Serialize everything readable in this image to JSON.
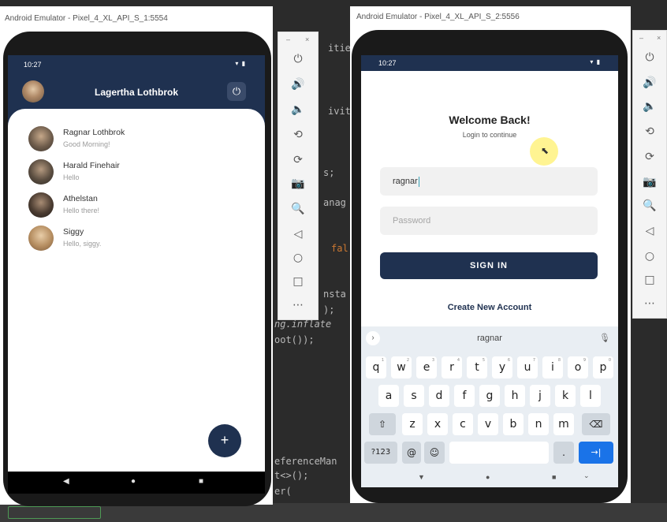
{
  "emulators": [
    {
      "title": "Android Emulator - Pixel_4_XL_API_S_1:5554"
    },
    {
      "title": "Android Emulator - Pixel_4_XL_API_S_2:5556"
    }
  ],
  "toolbar": {
    "minimize": "–",
    "close": "×",
    "icons": [
      "power-icon",
      "volume-up-icon",
      "volume-down-icon",
      "rotate-left-icon",
      "rotate-right-icon",
      "camera-icon",
      "zoom-icon",
      "back-icon",
      "home-icon",
      "overview-icon",
      "more-icon"
    ],
    "glyphs": [
      "⏻",
      "🔊",
      "🔈",
      "⟲",
      "⟳",
      "📷",
      "🔍",
      "◁",
      "○",
      "□",
      "⋯"
    ]
  },
  "ide": {
    "code_fragments": [
      "itie",
      "ivit",
      "s;",
      "anag",
      "fal",
      "nsta",
      ");",
      "ng.inflate",
      "oot());",
      "eferenceMan",
      "t<>();",
      "er("
    ]
  },
  "chat_app": {
    "status_time": "10:27",
    "status_icons": "▾ ▮",
    "header_title": "Lagertha Lothbrok",
    "power_glyph": "⏻",
    "contacts": [
      {
        "name": "Ragnar Lothbrok",
        "message": "Good Morning!"
      },
      {
        "name": "Harald Finehair",
        "message": "Hello"
      },
      {
        "name": "Athelstan",
        "message": "Hello there!"
      },
      {
        "name": "Siggy",
        "message": "Hello, siggy."
      }
    ],
    "fab_glyph": "+",
    "nav": {
      "back": "◀",
      "home": "●",
      "recents": "■"
    }
  },
  "login_app": {
    "status_time": "10:27",
    "status_icons": "▾ ▮",
    "title": "Welcome Back!",
    "subtitle": "Login to continue",
    "username_value": "ragnar",
    "password_placeholder": "Password",
    "sign_in_label": "SIGN IN",
    "create_account_label": "Create New Account",
    "pointer_glyph": "⬉"
  },
  "keyboard": {
    "suggestion": "ragnar",
    "chevron": "›",
    "mic": "🎙",
    "row1": [
      "q",
      "w",
      "e",
      "r",
      "t",
      "y",
      "u",
      "i",
      "o",
      "p"
    ],
    "row1_hints": [
      "1",
      "2",
      "3",
      "4",
      "5",
      "6",
      "7",
      "8",
      "9",
      "0"
    ],
    "row2": [
      "a",
      "s",
      "d",
      "f",
      "g",
      "h",
      "j",
      "k",
      "l"
    ],
    "row3": [
      "z",
      "x",
      "c",
      "v",
      "b",
      "n",
      "m"
    ],
    "shift": "⇧",
    "backspace": "⌫",
    "symbols": "?123",
    "at": "@",
    "emoji": "☺",
    "period": ".",
    "enter": "→|",
    "nav": {
      "back": "▼",
      "home": "●",
      "recents": "■",
      "keyboard": "⌄"
    }
  },
  "colors": {
    "primary": "#1f3150",
    "field_bg": "#f1f1f1",
    "keyboard_bg": "#e9eef3",
    "enter_key": "#1a73e8"
  }
}
